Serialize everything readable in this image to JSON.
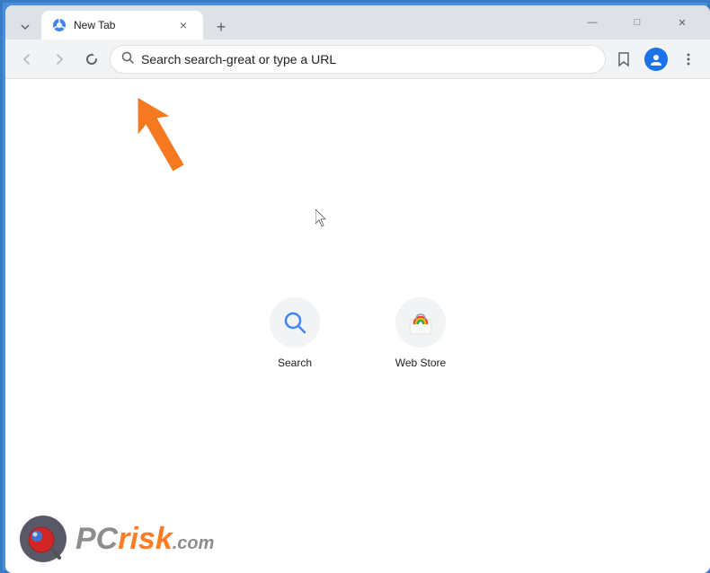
{
  "browser": {
    "tab": {
      "favicon": "🌐",
      "title": "New Tab",
      "close_label": "×"
    },
    "new_tab_label": "+",
    "window_controls": {
      "minimize": "—",
      "maximize": "□",
      "close": "✕"
    },
    "nav": {
      "back_label": "←",
      "forward_label": "→",
      "reload_label": "↻",
      "address_placeholder": "Search search-great or type a URL",
      "address_value": "Search search-great or type a URL"
    }
  },
  "shortcuts": [
    {
      "id": "search",
      "label": "Search",
      "type": "search"
    },
    {
      "id": "webstore",
      "label": "Web Store",
      "type": "webstore"
    }
  ],
  "watermark": {
    "pc": "PC",
    "risk": "risk",
    "domain": ".com"
  },
  "colors": {
    "accent_blue": "#1a73e8",
    "orange_arrow": "#f47920",
    "tab_bg": "#ffffff",
    "nav_bg": "#f1f3f4"
  }
}
